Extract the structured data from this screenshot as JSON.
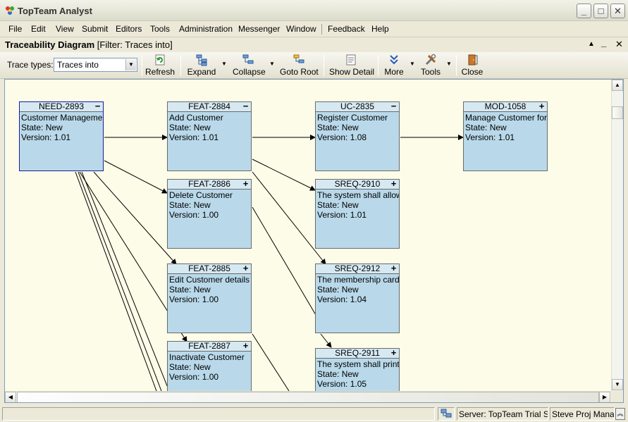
{
  "window": {
    "title": "TopTeam Analyst"
  },
  "menu": [
    "File",
    "Edit",
    "View",
    "Submit",
    "Editors",
    "Tools",
    "Administration",
    "Messenger",
    "Window",
    "Feedback",
    "Help"
  ],
  "diagram": {
    "title": "Traceability Diagram",
    "filter": "[Filter: Traces into]"
  },
  "toolbar": {
    "trace_types_label": "Trace types:",
    "trace_types_value": "Traces into",
    "buttons": [
      "Refresh",
      "Expand",
      "Collapse",
      "Goto Root",
      "Show Detail",
      "More",
      "Tools",
      "Close"
    ]
  },
  "nodes": [
    {
      "id": "NEED-2893",
      "toggle": "−",
      "line1": "Customer Management",
      "state": "State: New",
      "version": "Version: 1.01"
    },
    {
      "id": "FEAT-2884",
      "toggle": "−",
      "line1": "Add  Customer",
      "state": "State: New",
      "version": "Version: 1.01"
    },
    {
      "id": "UC-2835",
      "toggle": "−",
      "line1": "Register Customer",
      "state": "State: New",
      "version": "Version: 1.08"
    },
    {
      "id": "MOD-1058",
      "toggle": "+",
      "line1": "Manage Customer form",
      "state": "State: New",
      "version": "Version: 1.01"
    },
    {
      "id": "FEAT-2886",
      "toggle": "+",
      "line1": "Delete Customer",
      "state": "State: New",
      "version": "Version: 1.00"
    },
    {
      "id": "SREQ-2910",
      "toggle": "+",
      "line1": "The system shall allow...",
      "state": "State: New",
      "version": "Version: 1.01"
    },
    {
      "id": "FEAT-2885",
      "toggle": "+",
      "line1": "Edit Customer details",
      "state": "State: New",
      "version": "Version: 1.00"
    },
    {
      "id": "SREQ-2912",
      "toggle": "+",
      "line1": "The membership card ...",
      "state": "State: New",
      "version": "Version: 1.04"
    },
    {
      "id": "FEAT-2887",
      "toggle": "+",
      "line1": "Inactivate Customer",
      "state": "State: New",
      "version": "Version: 1.00"
    },
    {
      "id": "SREQ-2911",
      "toggle": "+",
      "line1": "The system shall print ...",
      "state": "State: New",
      "version": "Version: 1.05"
    }
  ],
  "status": {
    "server": "Server: TopTeam Trial Ser",
    "user": "Steve Proj Manage"
  },
  "colors": {
    "node_fill": "#b9d9ea",
    "node_header": "#d6e9f3",
    "canvas": "#fcfce8"
  }
}
